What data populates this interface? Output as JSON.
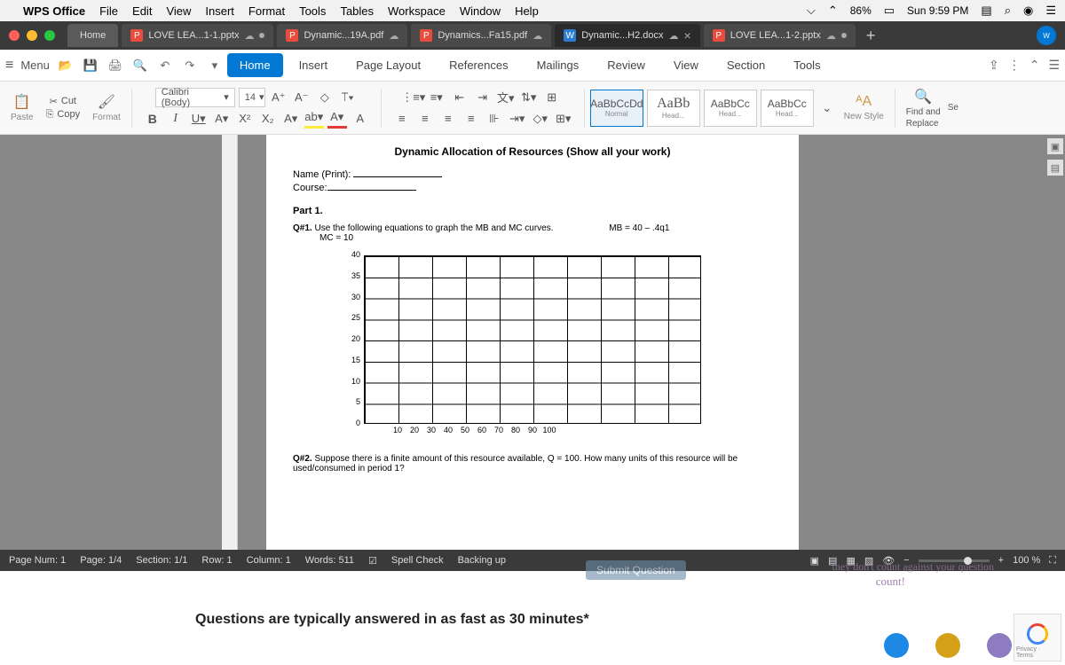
{
  "menubar": {
    "app": "WPS Office",
    "items": [
      "File",
      "Edit",
      "View",
      "Insert",
      "Format",
      "Tools",
      "Tables",
      "Workspace",
      "Window",
      "Help"
    ],
    "battery": "86%",
    "time": "Sun 9:59 PM"
  },
  "tabs": {
    "home": "Home",
    "items": [
      {
        "icon": "P",
        "label": "LOVE LEA...1-1.pptx",
        "cloud": true,
        "dot": true
      },
      {
        "icon": "P",
        "label": "Dynamic...19A.pdf",
        "cloud": true
      },
      {
        "icon": "P",
        "label": "Dynamics...Fa15.pdf",
        "cloud": true
      },
      {
        "icon": "W",
        "label": "Dynamic...H2.docx",
        "cloud": true,
        "close": true,
        "active": true
      },
      {
        "icon": "P",
        "label": "LOVE LEA...1-2.pptx",
        "cloud": true,
        "dot": true
      }
    ]
  },
  "ribbon": {
    "menu": "Menu",
    "tabs": [
      "Home",
      "Insert",
      "Page Layout",
      "References",
      "Mailings",
      "Review",
      "View",
      "Section",
      "Tools"
    ]
  },
  "toolbar": {
    "paste": "Paste",
    "cut": "Cut",
    "copy": "Copy",
    "format": "Format",
    "font": "Calibri (Body)",
    "size": "14",
    "styles": [
      {
        "sample": "AaBbCcDd",
        "name": "Normal"
      },
      {
        "sample": "AaBb",
        "name": "Head..."
      },
      {
        "sample": "AaBbCc",
        "name": "Head..."
      },
      {
        "sample": "AaBbCc",
        "name": "Head..."
      }
    ],
    "newstyle": "New Style",
    "find": "Find and",
    "replace": "Replace",
    "select": "Se"
  },
  "document": {
    "title": "Dynamic Allocation of Resources (Show all your work)",
    "name_label": "Name (Print):",
    "course_label": "Course:",
    "part1": "Part 1.",
    "q1": "Q#1.",
    "q1_text": " Use the following equations to graph the MB and MC curves.",
    "q1_eq1": "MB = 40 – .4q1",
    "q1_eq2": "MC = 10",
    "q2": "Q#2.",
    "q2_text": " Suppose there is a finite amount of this resource available, Q = 100. How many units of this resource will be used/consumed in period 1?"
  },
  "chart_data": {
    "type": "line",
    "title": "",
    "xlabel": "",
    "ylabel": "",
    "x_ticks": [
      10,
      20,
      30,
      40,
      50,
      60,
      70,
      80,
      90,
      100
    ],
    "y_ticks": [
      0,
      5,
      10,
      15,
      20,
      25,
      30,
      35,
      40
    ],
    "xlim": [
      0,
      100
    ],
    "ylim": [
      0,
      40
    ],
    "series": []
  },
  "statusbar": {
    "pagenum": "Page Num: 1",
    "page": "Page: 1/4",
    "section": "Section: 1/1",
    "row": "Row: 1",
    "column": "Column: 1",
    "words": "Words: 511",
    "spell": "Spell Check",
    "backing": "Backing up",
    "zoom": "100 %"
  },
  "background": {
    "submit": "Submit Question",
    "text1": "they don't count against your question",
    "text2": "count!",
    "text3": "Questions are typically answered in as fast as 30 minutes*",
    "recaptcha": "Privacy · Terms"
  }
}
